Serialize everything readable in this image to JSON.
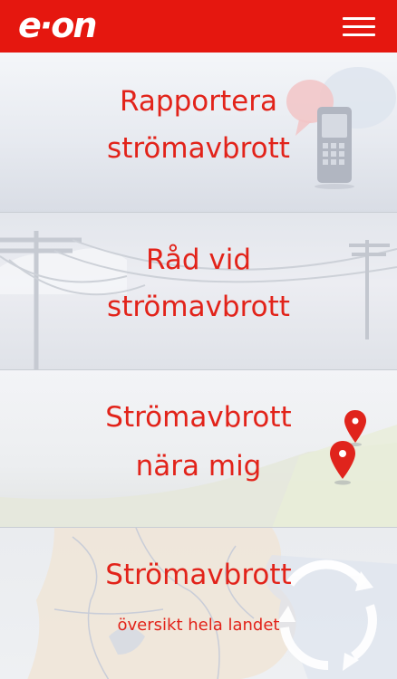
{
  "header": {
    "logo_text": "e·on",
    "menu_icon": "hamburger-menu-icon",
    "background_color": "#e5170f"
  },
  "tiles": [
    {
      "line1": "Rapportera",
      "line2": "strömavbrott",
      "icon": "mobile-phone-speech-bubble-icon"
    },
    {
      "line1": "Råd vid",
      "line2": "strömavbrott",
      "icon": "power-line-pylons-icon"
    },
    {
      "line1": "Strömavbrott",
      "line2": "nära mig",
      "icon": "map-pin-icon"
    },
    {
      "line1": "Strömavbrott",
      "line2": "översikt hela landet",
      "icon": "sweden-map-refresh-icon"
    }
  ],
  "accent_color": "#e2231a"
}
